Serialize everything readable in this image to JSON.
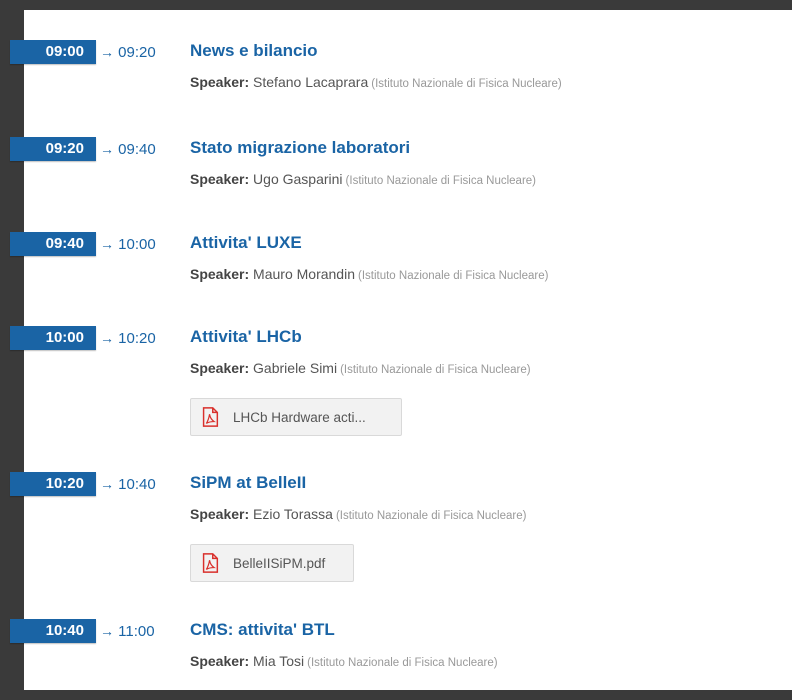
{
  "timetable": [
    {
      "start": "09:00",
      "end": "09:20",
      "arrow": "→",
      "title": "News e bilancio",
      "speaker_label": "Speaker:",
      "speaker": "Stefano Lacaprara",
      "affiliation": "(Istituto Nazionale di Fisica Nucleare)",
      "attachment": null
    },
    {
      "start": "09:20",
      "end": "09:40",
      "arrow": "→",
      "title": "Stato migrazione laboratori",
      "speaker_label": "Speaker:",
      "speaker": "Ugo Gasparini",
      "affiliation": "(Istituto Nazionale di Fisica Nucleare)",
      "attachment": null
    },
    {
      "start": "09:40",
      "end": "10:00",
      "arrow": "→",
      "title": "Attivita' LUXE",
      "speaker_label": "Speaker:",
      "speaker": "Mauro Morandin",
      "affiliation": "(Istituto Nazionale di Fisica Nucleare)",
      "attachment": null
    },
    {
      "start": "10:00",
      "end": "10:20",
      "arrow": "→",
      "title": "Attivita' LHCb",
      "speaker_label": "Speaker:",
      "speaker": "Gabriele Simi",
      "affiliation": "(Istituto Nazionale di Fisica Nucleare)",
      "attachment": "LHCb Hardware acti..."
    },
    {
      "start": "10:20",
      "end": "10:40",
      "arrow": "→",
      "title": "SiPM at BelleII",
      "speaker_label": "Speaker:",
      "speaker": "Ezio Torassa",
      "affiliation": "(Istituto Nazionale di Fisica Nucleare)",
      "attachment": "BelleIISiPM.pdf"
    },
    {
      "start": "10:40",
      "end": "11:00",
      "arrow": "→",
      "title": "CMS: attivita' BTL",
      "speaker_label": "Speaker:",
      "speaker": "Mia Tosi",
      "affiliation": "(Istituto Nazionale di Fisica Nucleare)",
      "attachment": null
    }
  ],
  "icons": {
    "attachment": "pdf-file-icon"
  },
  "colors": {
    "accent": "#1a64a5",
    "pdf_red": "#d9302c",
    "page_bg": "#3a3a3a"
  }
}
